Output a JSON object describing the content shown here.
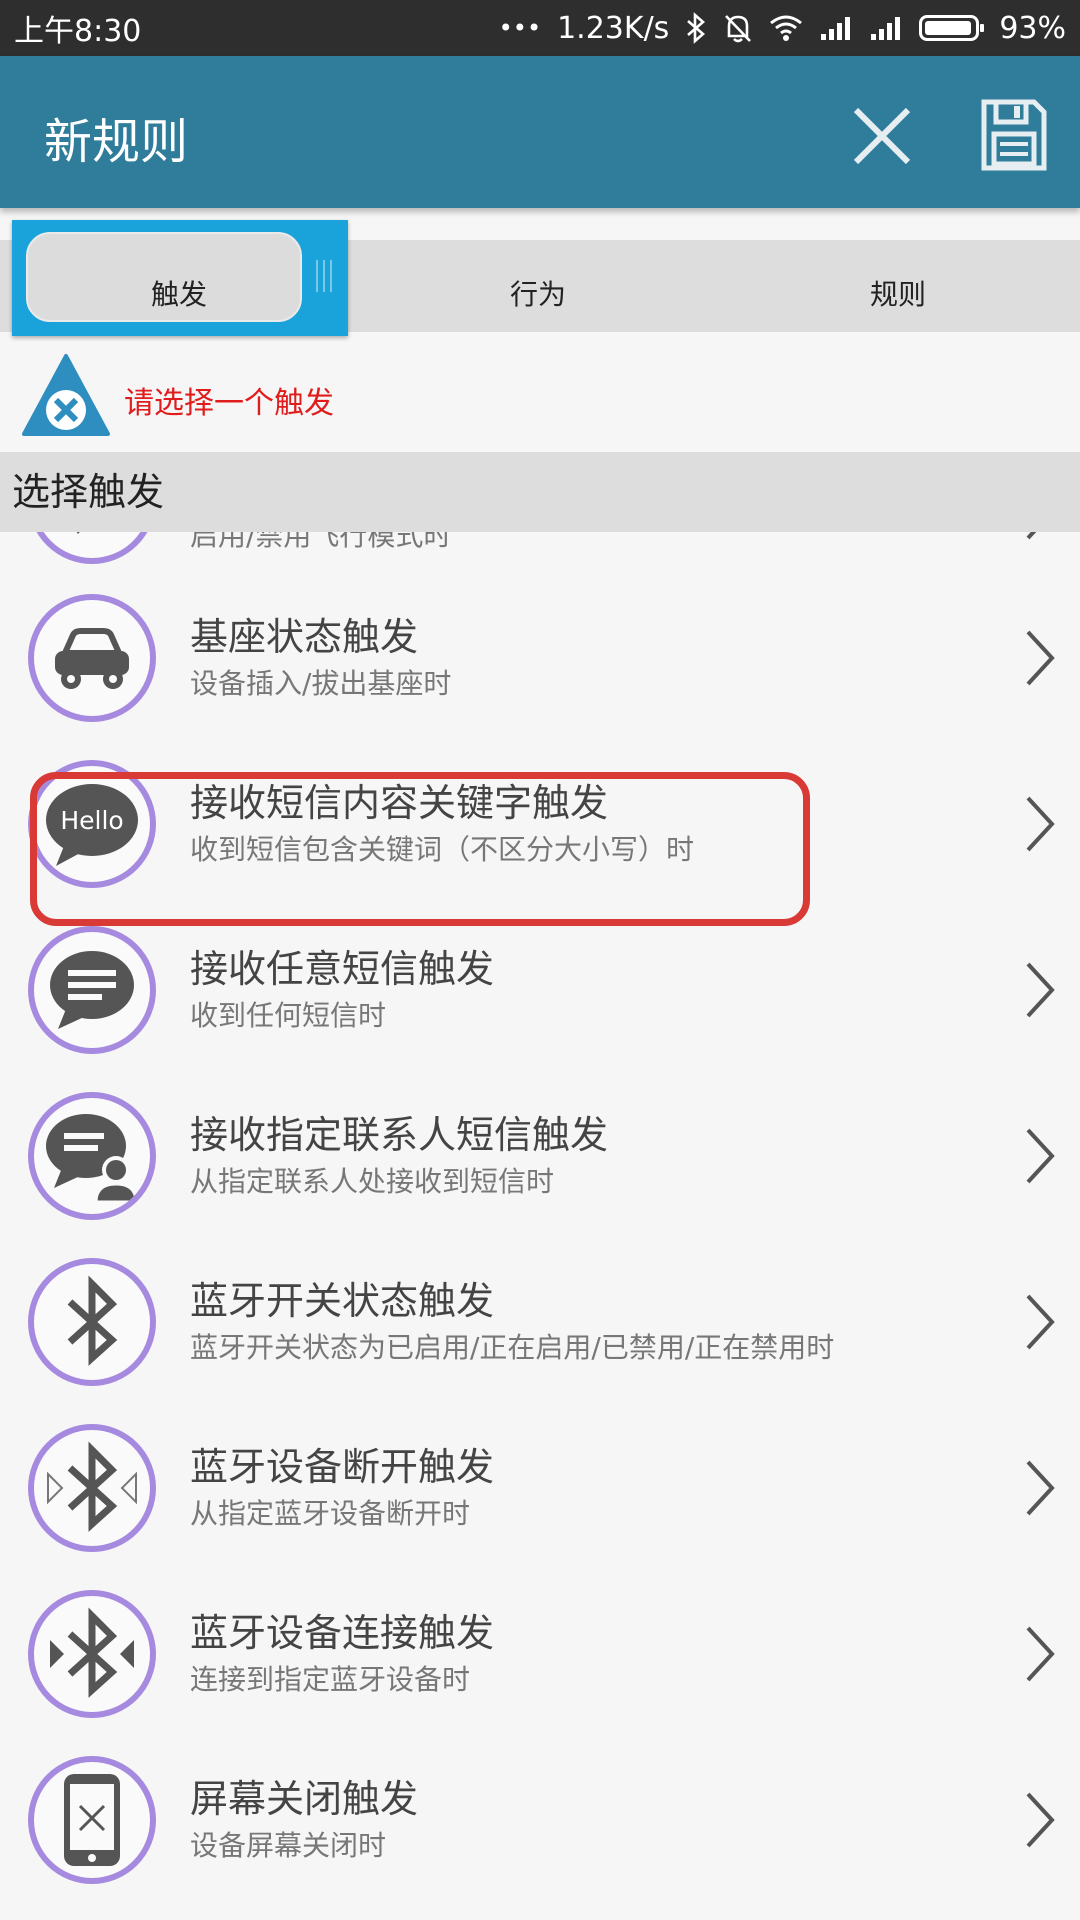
{
  "status_bar": {
    "time": "上午8:30",
    "dots": "•••",
    "net_speed": "1.23K/s",
    "battery": "93%"
  },
  "app_bar": {
    "title": "新规则"
  },
  "tabs": [
    {
      "label": "触发",
      "selected": true
    },
    {
      "label": "行为",
      "selected": false
    },
    {
      "label": "规则",
      "selected": false
    }
  ],
  "warning": {
    "text": "请选择一个触发",
    "color": "#e01c1c"
  },
  "section": {
    "title": "选择触发"
  },
  "items": [
    {
      "title": "",
      "subtitle": "启用/禁用飞行模式时",
      "icon": "airplane-icon"
    },
    {
      "title": "基座状态触发",
      "subtitle": "设备插入/拔出基座时",
      "icon": "car-icon"
    },
    {
      "title": "接收短信内容关键字触发",
      "subtitle": "收到短信包含关键词（不区分大小写）时",
      "icon": "hello-bubble-icon",
      "hello": "Hello",
      "highlighted": true
    },
    {
      "title": "接收任意短信触发",
      "subtitle": "收到任何短信时",
      "icon": "message-bubble-icon"
    },
    {
      "title": "接收指定联系人短信触发",
      "subtitle": "从指定联系人处接收到短信时",
      "icon": "contact-message-icon"
    },
    {
      "title": "蓝牙开关状态触发",
      "subtitle": "蓝牙开关状态为已启用/正在启用/已禁用/正在禁用时",
      "icon": "bluetooth-icon"
    },
    {
      "title": "蓝牙设备断开触发",
      "subtitle": "从指定蓝牙设备断开时",
      "icon": "bluetooth-disconnect-icon"
    },
    {
      "title": "蓝牙设备连接触发",
      "subtitle": "连接到指定蓝牙设备时",
      "icon": "bluetooth-connect-icon"
    },
    {
      "title": "屏幕关闭触发",
      "subtitle": "设备屏幕关闭时",
      "icon": "screen-off-icon"
    }
  ],
  "colors": {
    "accent": "#2f7d9b",
    "tab_highlight": "#1aa3da",
    "icon_ring": "#a58ae0",
    "highlight_box": "#d93a36"
  }
}
